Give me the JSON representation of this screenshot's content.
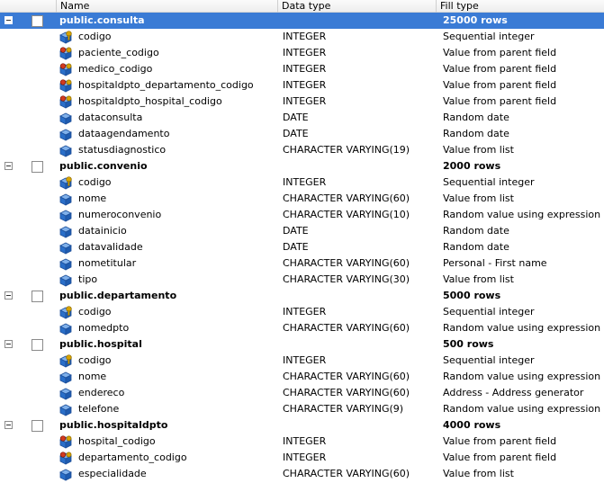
{
  "columns": {
    "name": "Name",
    "data_type": "Data type",
    "fill_type": "Fill type"
  },
  "colors": {
    "selection": "#3a7bd5",
    "field_icon_blue": "#2a6fc9",
    "key_icon_gold": "#d9a400",
    "fk_icon_red": "#d33a1f"
  },
  "tables": [
    {
      "name": "public.consulta",
      "rows": "25000 rows",
      "selected": true,
      "fields": [
        {
          "name": "codigo",
          "type": "INTEGER",
          "fill": "Sequential integer",
          "icon": "primary-key-field-icon"
        },
        {
          "name": "paciente_codigo",
          "type": "INTEGER",
          "fill": "Value from parent field",
          "icon": "foreign-key-field-icon"
        },
        {
          "name": "medico_codigo",
          "type": "INTEGER",
          "fill": "Value from parent field",
          "icon": "foreign-key-field-icon"
        },
        {
          "name": "hospitaldpto_departamento_codigo",
          "type": "INTEGER",
          "fill": "Value from parent field",
          "icon": "foreign-key-field-icon"
        },
        {
          "name": "hospitaldpto_hospital_codigo",
          "type": "INTEGER",
          "fill": "Value from parent field",
          "icon": "foreign-key-field-icon"
        },
        {
          "name": "dataconsulta",
          "type": "DATE",
          "fill": "Random date",
          "icon": "field-icon"
        },
        {
          "name": "dataagendamento",
          "type": "DATE",
          "fill": "Random date",
          "icon": "field-icon"
        },
        {
          "name": "statusdiagnostico",
          "type": "CHARACTER VARYING(19)",
          "fill": "Value from list",
          "icon": "field-icon"
        }
      ]
    },
    {
      "name": "public.convenio",
      "rows": "2000 rows",
      "selected": false,
      "fields": [
        {
          "name": "codigo",
          "type": "INTEGER",
          "fill": "Sequential integer",
          "icon": "primary-key-field-icon"
        },
        {
          "name": "nome",
          "type": "CHARACTER VARYING(60)",
          "fill": "Value from list",
          "icon": "field-icon"
        },
        {
          "name": "numeroconvenio",
          "type": "CHARACTER VARYING(10)",
          "fill": "Random value using expression",
          "icon": "field-icon"
        },
        {
          "name": "datainicio",
          "type": "DATE",
          "fill": "Random date",
          "icon": "field-icon"
        },
        {
          "name": "datavalidade",
          "type": "DATE",
          "fill": "Random date",
          "icon": "field-icon"
        },
        {
          "name": "nometitular",
          "type": "CHARACTER VARYING(60)",
          "fill": "Personal - First name",
          "icon": "field-icon"
        },
        {
          "name": "tipo",
          "type": "CHARACTER VARYING(30)",
          "fill": "Value from list",
          "icon": "field-icon"
        }
      ]
    },
    {
      "name": "public.departamento",
      "rows": "5000 rows",
      "selected": false,
      "fields": [
        {
          "name": "codigo",
          "type": "INTEGER",
          "fill": "Sequential integer",
          "icon": "primary-key-field-icon"
        },
        {
          "name": "nomedpto",
          "type": "CHARACTER VARYING(60)",
          "fill": "Random value using expression",
          "icon": "field-icon"
        }
      ]
    },
    {
      "name": "public.hospital",
      "rows": "500 rows",
      "selected": false,
      "fields": [
        {
          "name": "codigo",
          "type": "INTEGER",
          "fill": "Sequential integer",
          "icon": "primary-key-field-icon"
        },
        {
          "name": "nome",
          "type": "CHARACTER VARYING(60)",
          "fill": "Random value using expression",
          "icon": "field-icon"
        },
        {
          "name": "endereco",
          "type": "CHARACTER VARYING(60)",
          "fill": "Address - Address generator",
          "icon": "field-icon"
        },
        {
          "name": "telefone",
          "type": "CHARACTER VARYING(9)",
          "fill": "Random value using expression",
          "icon": "field-icon"
        }
      ]
    },
    {
      "name": "public.hospitaldpto",
      "rows": "4000 rows",
      "selected": false,
      "fields": [
        {
          "name": "hospital_codigo",
          "type": "INTEGER",
          "fill": "Value from parent field",
          "icon": "foreign-key-field-icon"
        },
        {
          "name": "departamento_codigo",
          "type": "INTEGER",
          "fill": "Value from parent field",
          "icon": "foreign-key-field-icon"
        },
        {
          "name": "especialidade",
          "type": "CHARACTER VARYING(60)",
          "fill": "Value from list",
          "icon": "field-icon"
        }
      ]
    }
  ]
}
